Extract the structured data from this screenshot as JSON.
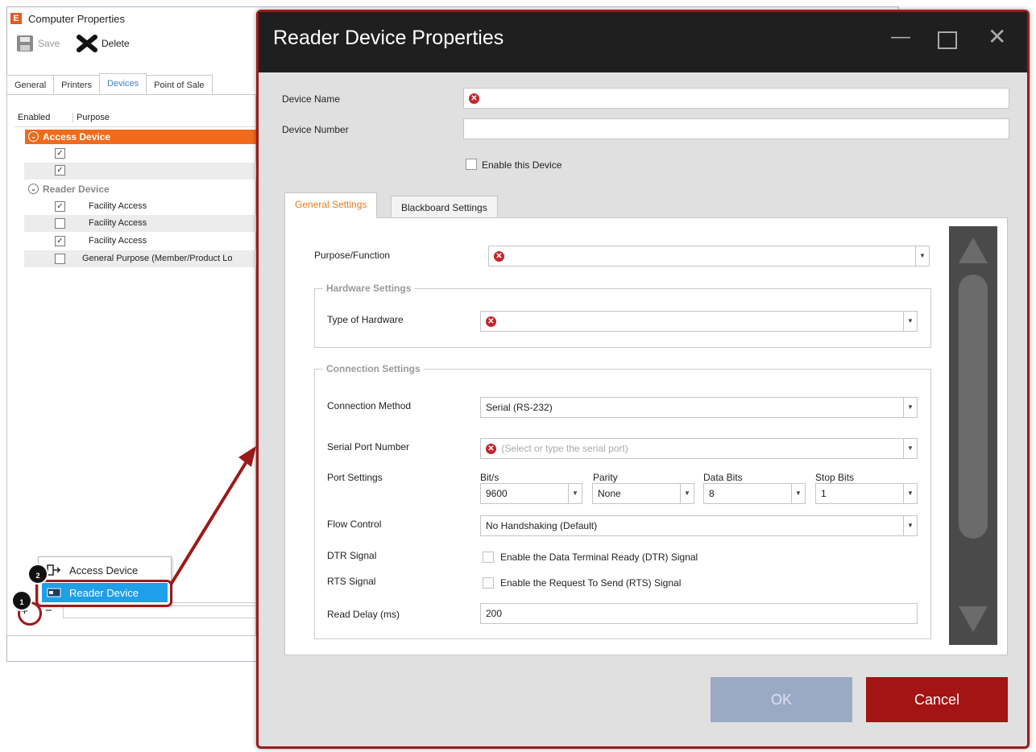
{
  "bg_window": {
    "title": "Computer Properties",
    "logo_letter": "E",
    "toolbar": {
      "save_label": "Save",
      "delete_label": "Delete"
    },
    "tabs": [
      "General",
      "Printers",
      "Devices",
      "Point of Sale"
    ],
    "active_tab": "Devices",
    "grid": {
      "headers": [
        "Enabled",
        "Purpose"
      ],
      "groups": [
        {
          "name": "Access Device",
          "rows": [
            {
              "checked": true,
              "purpose": ""
            },
            {
              "checked": true,
              "purpose": ""
            }
          ]
        },
        {
          "name": "Reader Device",
          "rows": [
            {
              "checked": true,
              "purpose": "Facility Access"
            },
            {
              "checked": false,
              "purpose": "Facility Access"
            },
            {
              "checked": true,
              "purpose": "Facility Access"
            },
            {
              "checked": false,
              "purpose": "General Purpose (Member/Product Lo"
            }
          ]
        }
      ]
    },
    "add_menu": [
      "Access Device",
      "Reader Device"
    ],
    "steps": [
      "1",
      "2"
    ]
  },
  "dialog": {
    "title": "Reader Device Properties",
    "device_name_label": "Device Name",
    "device_number_label": "Device Number",
    "enable_label": "Enable this Device",
    "tabs": [
      "General Settings",
      "Blackboard Settings"
    ],
    "purpose_label": "Purpose/Function",
    "hardware_group": "Hardware Settings",
    "hardware_type_label": "Type of Hardware",
    "connection_group": "Connection Settings",
    "connection_method_label": "Connection Method",
    "connection_method_value": "Serial (RS-232)",
    "serial_port_label": "Serial Port Number",
    "serial_port_placeholder": "(Select or type the serial port)",
    "port_settings_label": "Port Settings",
    "port": {
      "bits_label": "Bit/s",
      "bits_value": "9600",
      "parity_label": "Parity",
      "parity_value": "None",
      "data_bits_label": "Data Bits",
      "data_bits_value": "8",
      "stop_bits_label": "Stop Bits",
      "stop_bits_value": "1"
    },
    "flow_control_label": "Flow Control",
    "flow_control_value": "No Handshaking (Default)",
    "dtr_label": "DTR Signal",
    "dtr_text": "Enable the Data Terminal Ready (DTR) Signal",
    "rts_label": "RTS Signal",
    "rts_text": "Enable the Request To Send (RTS) Signal",
    "read_delay_label": "Read Delay (ms)",
    "read_delay_value": "200",
    "ok_label": "OK",
    "cancel_label": "Cancel"
  },
  "colors": {
    "accent_orange": "#f26a1b",
    "selected_blue": "#1e9fe8",
    "cancel_red": "#a31414",
    "ok_disabled": "#9aa9c4",
    "annotation_red": "#9c1a1a"
  }
}
